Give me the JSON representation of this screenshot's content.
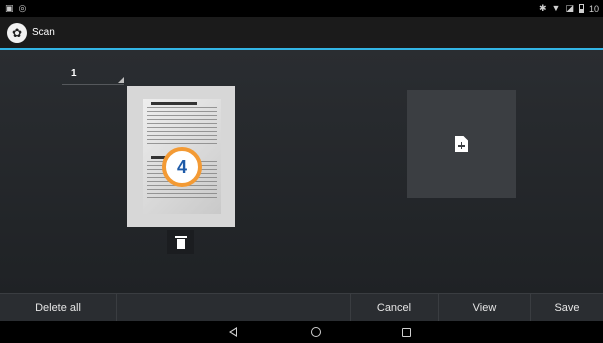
{
  "status_bar": {
    "left_icons": [
      "screenshot-icon",
      "android-icon"
    ],
    "right_icons": [
      "bluetooth-icon",
      "wifi-icon",
      "signal-icon",
      "battery-icon"
    ],
    "time": "10"
  },
  "action_bar": {
    "title": "Scan",
    "accent_color": "#33b5e5"
  },
  "pages": {
    "current_page": "1",
    "thumbnail_badge": "4",
    "badge_color": "#f39a34"
  },
  "bottom_bar": {
    "delete_all": "Delete all",
    "cancel": "Cancel",
    "view": "View",
    "save": "Save"
  },
  "nav_bar": {
    "icons": [
      "back-icon",
      "home-icon",
      "recents-icon"
    ]
  }
}
